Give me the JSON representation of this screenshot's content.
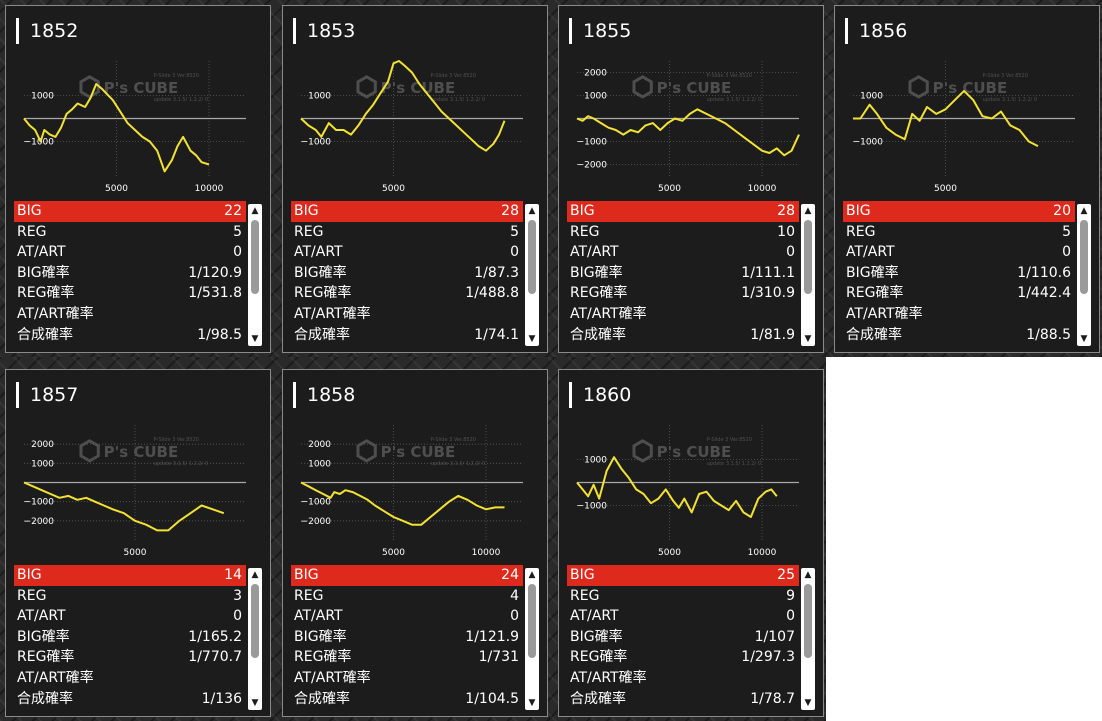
{
  "watermark": {
    "brand": "P's CUBE",
    "line1": "P-Slide 3 Ver.8520",
    "line2": "update 3.1.5/ 1.2.2/ 0"
  },
  "stat_labels": {
    "big": "BIG",
    "reg": "REG",
    "at_art": "AT/ART",
    "big_prob": "BIG確率",
    "reg_prob": "REG確率",
    "at_art_prob": "AT/ART確率",
    "combined_prob": "合成確率"
  },
  "colors": {
    "highlight": "#dd2a1c",
    "line": "#f2e232",
    "card_bg": "#1c1c1c",
    "border": "#8a8a8a"
  },
  "icons": [
    "scroll-up-arrow-icon",
    "scroll-down-arrow-icon",
    "cube-logo-icon"
  ],
  "machines": [
    {
      "number": "1852",
      "big": "22",
      "reg": "5",
      "at_art": "0",
      "big_prob": "1/120.9",
      "reg_prob": "1/531.8",
      "at_art_prob": "",
      "combined_prob": "1/98.5"
    },
    {
      "number": "1853",
      "big": "28",
      "reg": "5",
      "at_art": "0",
      "big_prob": "1/87.3",
      "reg_prob": "1/488.8",
      "at_art_prob": "",
      "combined_prob": "1/74.1"
    },
    {
      "number": "1855",
      "big": "28",
      "reg": "10",
      "at_art": "0",
      "big_prob": "1/111.1",
      "reg_prob": "1/310.9",
      "at_art_prob": "",
      "combined_prob": "1/81.9"
    },
    {
      "number": "1856",
      "big": "20",
      "reg": "5",
      "at_art": "0",
      "big_prob": "1/110.6",
      "reg_prob": "1/442.4",
      "at_art_prob": "",
      "combined_prob": "1/88.5"
    },
    {
      "number": "1857",
      "big": "14",
      "reg": "3",
      "at_art": "0",
      "big_prob": "1/165.2",
      "reg_prob": "1/770.7",
      "at_art_prob": "",
      "combined_prob": "1/136"
    },
    {
      "number": "1858",
      "big": "24",
      "reg": "4",
      "at_art": "0",
      "big_prob": "1/121.9",
      "reg_prob": "1/731",
      "at_art_prob": "",
      "combined_prob": "1/104.5"
    },
    {
      "number": "1860",
      "big": "25",
      "reg": "9",
      "at_art": "0",
      "big_prob": "1/107",
      "reg_prob": "1/297.3",
      "at_art_prob": "",
      "combined_prob": "1/78.7"
    }
  ],
  "chart_data": [
    {
      "type": "line",
      "machine": "1852",
      "xlim": [
        0,
        12000
      ],
      "ylim": [
        -2500,
        2500
      ],
      "yticks": [
        1000,
        -1000
      ],
      "xticks": [
        5000,
        10000
      ],
      "x": [
        0,
        300,
        600,
        900,
        1100,
        1400,
        1700,
        2000,
        2300,
        2600,
        2900,
        3300,
        3600,
        3900,
        4200,
        4500,
        4800,
        5200,
        5600,
        6000,
        6400,
        6800,
        7200,
        7600,
        8000,
        8300,
        8600,
        9000,
        9300,
        9600,
        10000
      ],
      "y": [
        0,
        -300,
        -500,
        -1000,
        -500,
        -700,
        -800,
        -400,
        200,
        400,
        650,
        500,
        900,
        1500,
        1300,
        1050,
        800,
        300,
        -200,
        -500,
        -800,
        -1000,
        -1400,
        -2300,
        -1800,
        -1200,
        -800,
        -1400,
        -1600,
        -1900,
        -2000
      ]
    },
    {
      "type": "line",
      "machine": "1853",
      "xlim": [
        0,
        12000
      ],
      "ylim": [
        -2500,
        2500
      ],
      "yticks": [
        1000,
        -1000
      ],
      "xticks": [
        5000
      ],
      "x": [
        0,
        400,
        800,
        1100,
        1500,
        1900,
        2300,
        2700,
        3100,
        3500,
        3900,
        4300,
        4700,
        5000,
        5300,
        5600,
        6000,
        6400,
        6800,
        7200,
        7600,
        8000,
        8400,
        8800,
        9200,
        9600,
        10000,
        10400,
        10700,
        11000
      ],
      "y": [
        0,
        -300,
        -500,
        -800,
        -200,
        -500,
        -500,
        -700,
        -300,
        200,
        600,
        1100,
        1600,
        2400,
        2500,
        2300,
        2000,
        1500,
        1100,
        700,
        300,
        0,
        -300,
        -600,
        -900,
        -1200,
        -1400,
        -1100,
        -700,
        -100
      ]
    },
    {
      "type": "line",
      "machine": "1855",
      "xlim": [
        0,
        12000
      ],
      "ylim": [
        -2500,
        2500
      ],
      "yticks": [
        2000,
        1000,
        -1000,
        -2000
      ],
      "xticks": [
        5000,
        10000
      ],
      "x": [
        0,
        300,
        600,
        900,
        1300,
        1700,
        2100,
        2500,
        2900,
        3300,
        3700,
        4100,
        4500,
        4900,
        5300,
        5700,
        6100,
        6500,
        7000,
        7500,
        8000,
        8500,
        9000,
        9500,
        10000,
        10400,
        10800,
        11200,
        11600,
        12000
      ],
      "y": [
        0,
        -100,
        100,
        0,
        -200,
        -400,
        -500,
        -700,
        -500,
        -600,
        -300,
        -200,
        -500,
        -200,
        0,
        -100,
        200,
        400,
        200,
        0,
        -200,
        -500,
        -800,
        -1100,
        -1400,
        -1500,
        -1300,
        -1600,
        -1400,
        -700
      ]
    },
    {
      "type": "line",
      "machine": "1856",
      "xlim": [
        0,
        12000
      ],
      "ylim": [
        -2500,
        2500
      ],
      "yticks": [
        1000,
        -1000
      ],
      "xticks": [
        5000
      ],
      "x": [
        0,
        400,
        900,
        1300,
        1800,
        2300,
        2800,
        3200,
        3600,
        4000,
        4500,
        5000,
        5500,
        6000,
        6500,
        7000,
        7500,
        8000,
        8500,
        9000,
        9500,
        10000
      ],
      "y": [
        0,
        0,
        600,
        200,
        -400,
        -700,
        -900,
        200,
        -100,
        500,
        200,
        400,
        800,
        1200,
        800,
        100,
        0,
        300,
        -300,
        -500,
        -1000,
        -1200
      ]
    },
    {
      "type": "line",
      "machine": "1857",
      "xlim": [
        0,
        10000
      ],
      "ylim": [
        -3000,
        3000
      ],
      "yticks": [
        2000,
        1000,
        -1000,
        -2000
      ],
      "xticks": [
        5000
      ],
      "x": [
        0,
        400,
        800,
        1200,
        1600,
        2000,
        2400,
        2800,
        3200,
        3600,
        4000,
        4500,
        5000,
        5500,
        6000,
        6500,
        7000,
        7500,
        8000,
        8500,
        9000
      ],
      "y": [
        0,
        -200,
        -400,
        -600,
        -800,
        -700,
        -900,
        -800,
        -1000,
        -1200,
        -1400,
        -1600,
        -2000,
        -2200,
        -2500,
        -2500,
        -2000,
        -1600,
        -1200,
        -1400,
        -1600
      ]
    },
    {
      "type": "line",
      "machine": "1858",
      "xlim": [
        0,
        12000
      ],
      "ylim": [
        -3000,
        3000
      ],
      "yticks": [
        2000,
        1000,
        -1000,
        -2000
      ],
      "xticks": [
        5000,
        10000
      ],
      "x": [
        0,
        400,
        800,
        1200,
        1600,
        1800,
        2100,
        2400,
        2800,
        3200,
        3600,
        4000,
        4500,
        5000,
        5500,
        6000,
        6500,
        7000,
        7500,
        8000,
        8500,
        9000,
        9500,
        10000,
        10500,
        11000
      ],
      "y": [
        0,
        -200,
        -400,
        -600,
        -800,
        -500,
        -600,
        -400,
        -500,
        -700,
        -900,
        -1200,
        -1500,
        -1800,
        -2000,
        -2200,
        -2200,
        -1800,
        -1400,
        -1000,
        -700,
        -900,
        -1200,
        -1400,
        -1300,
        -1300
      ]
    },
    {
      "type": "line",
      "machine": "1860",
      "xlim": [
        0,
        12000
      ],
      "ylim": [
        -2500,
        2500
      ],
      "yticks": [
        1000,
        -1000
      ],
      "xticks": [
        5000,
        10000
      ],
      "x": [
        0,
        300,
        600,
        900,
        1200,
        1600,
        2000,
        2400,
        2800,
        3200,
        3600,
        4000,
        4400,
        4800,
        5200,
        5500,
        5800,
        6200,
        6600,
        7000,
        7400,
        7800,
        8200,
        8600,
        9000,
        9400,
        9800,
        10200,
        10500,
        10800
      ],
      "y": [
        0,
        -300,
        -600,
        -100,
        -700,
        500,
        1100,
        600,
        200,
        -300,
        -500,
        -900,
        -700,
        -300,
        -800,
        -1100,
        -700,
        -1300,
        -500,
        -400,
        -800,
        -1000,
        -1200,
        -800,
        -1300,
        -1500,
        -700,
        -400,
        -300,
        -600
      ]
    }
  ]
}
